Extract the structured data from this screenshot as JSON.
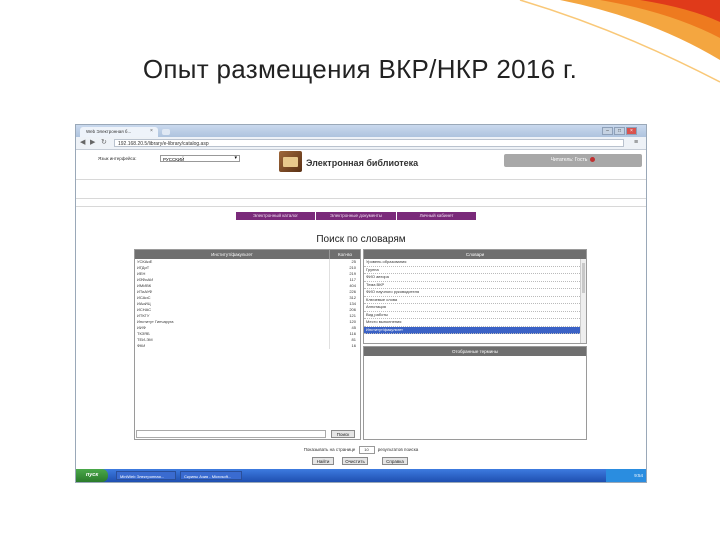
{
  "slide": {
    "title": "Опыт размещения ВКР/НКР 2016 г."
  },
  "browser": {
    "tab_title": "Web Электронная б...",
    "url": "192.168.20.5/library/e-library/catalog.asp",
    "minimize": "–",
    "maximize": "□",
    "close": "×"
  },
  "page": {
    "language_label": "Язык интерфейса:",
    "language_value": "РУССКИЙ",
    "library_title": "Электронная библиотека",
    "reader_label": "Читатель: Гость",
    "menu": [
      "Электронный каталог",
      "Электронные документы",
      "Личный кабинет"
    ],
    "search_title": "Поиск по словарям",
    "institutes_header": {
      "col1": "Институт/факультет",
      "col2": "Кол-во"
    },
    "institutes": [
      {
        "name": "УСКАиЕ",
        "count": "25"
      },
      {
        "name": "ИГДиТ",
        "count": "210"
      },
      {
        "name": "ИЕН",
        "count": "219"
      },
      {
        "name": "ИЗФиАИ",
        "count": "117"
      },
      {
        "name": "ИМИВК",
        "count": "404"
      },
      {
        "name": "ИТиАУФ",
        "count": "226"
      },
      {
        "name": "ИСАиС",
        "count": "312"
      },
      {
        "name": "ИАиИЦ",
        "count": "134"
      },
      {
        "name": "ИСНАС",
        "count": "206"
      },
      {
        "name": "ИТКГУ",
        "count": "121"
      },
      {
        "name": "Институт Гинчаруга",
        "count": "120"
      },
      {
        "name": "ИИФ",
        "count": "45"
      },
      {
        "name": "ТКЗЯБ",
        "count": "116"
      },
      {
        "name": "ТЕИ-ЭМ",
        "count": "81"
      },
      {
        "name": "ФКИ",
        "count": "16"
      }
    ],
    "search_button": "Поиск",
    "dictionaries_header": "Словари",
    "dictionaries": [
      {
        "label": "Уровень образования",
        "selected": false
      },
      {
        "label": "Группа",
        "selected": false
      },
      {
        "label": "ФИО автора",
        "selected": false
      },
      {
        "label": "Тема ВКР",
        "selected": false
      },
      {
        "label": "ФИО научного руководителя",
        "selected": false
      },
      {
        "label": "Ключевые слова",
        "selected": false
      },
      {
        "label": "Аннотация",
        "selected": false
      },
      {
        "label": "Вид работы",
        "selected": false
      },
      {
        "label": "Место выполнения",
        "selected": false
      },
      {
        "label": "Институт/факультет",
        "selected": true
      }
    ],
    "selected_terms": "Отобранные термины",
    "per_page_prefix": "Показывать на странице",
    "per_page_value": "10",
    "per_page_suffix": "результатов поиска",
    "buttons": {
      "find": "Найти",
      "clear": "Очистить",
      "help": "Справка"
    }
  },
  "taskbar": {
    "start": "пуск",
    "tasks": [
      "MiniWeb Электронная...",
      "Скрины Азия - Microsoft..."
    ],
    "clock": "9:54"
  }
}
